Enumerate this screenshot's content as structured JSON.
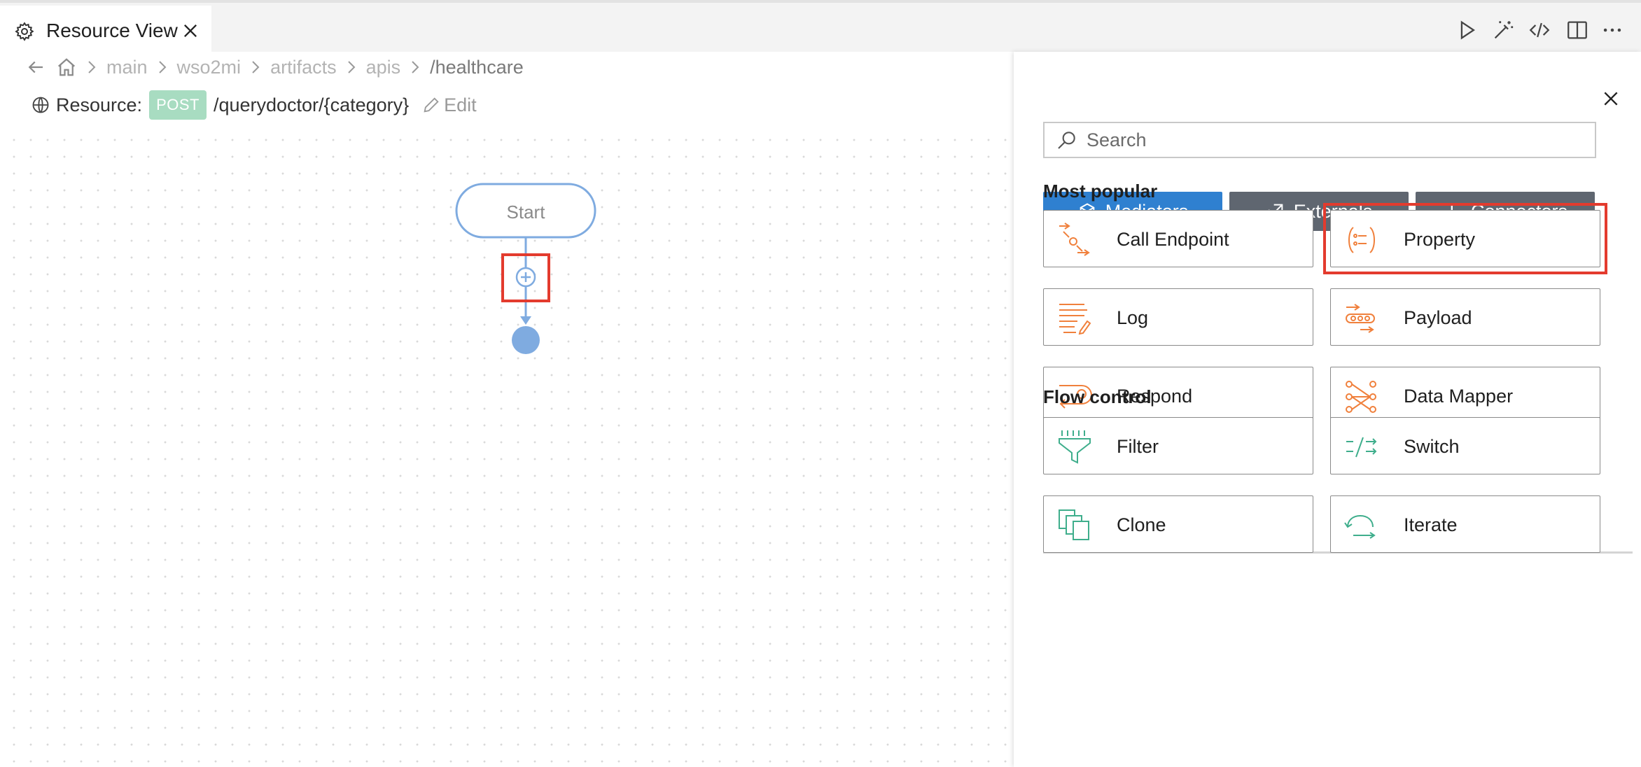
{
  "tab": {
    "title": "Resource View"
  },
  "breadcrumb": [
    "main",
    "wso2mi",
    "artifacts",
    "apis",
    "/healthcare"
  ],
  "resource": {
    "label": "Resource:",
    "method": "POST",
    "path": "/querydoctor/{category}",
    "edit": "Edit"
  },
  "canvas": {
    "start_label": "Start"
  },
  "panel": {
    "search_placeholder": "Search",
    "tabs": [
      {
        "label": "Mediators",
        "icon": "cube-icon",
        "active": true
      },
      {
        "label": "Externals",
        "icon": "external-icon",
        "active": false
      },
      {
        "label": "Connectors",
        "icon": "connector-icon",
        "active": false
      }
    ],
    "sections": [
      {
        "title": "Most popular",
        "items": [
          "Call Endpoint",
          "Property",
          "Log",
          "Payload",
          "Respond",
          "Data Mapper"
        ]
      },
      {
        "title": "Flow control",
        "items": [
          "Filter",
          "Switch",
          "Clone",
          "Iterate"
        ]
      }
    ]
  },
  "colors": {
    "accent": "#2f80d0",
    "orange_icon": "#f0803c",
    "green_icon": "#3fae8c",
    "highlight": "#e33b2e",
    "node_blue": "#7fabe0"
  }
}
